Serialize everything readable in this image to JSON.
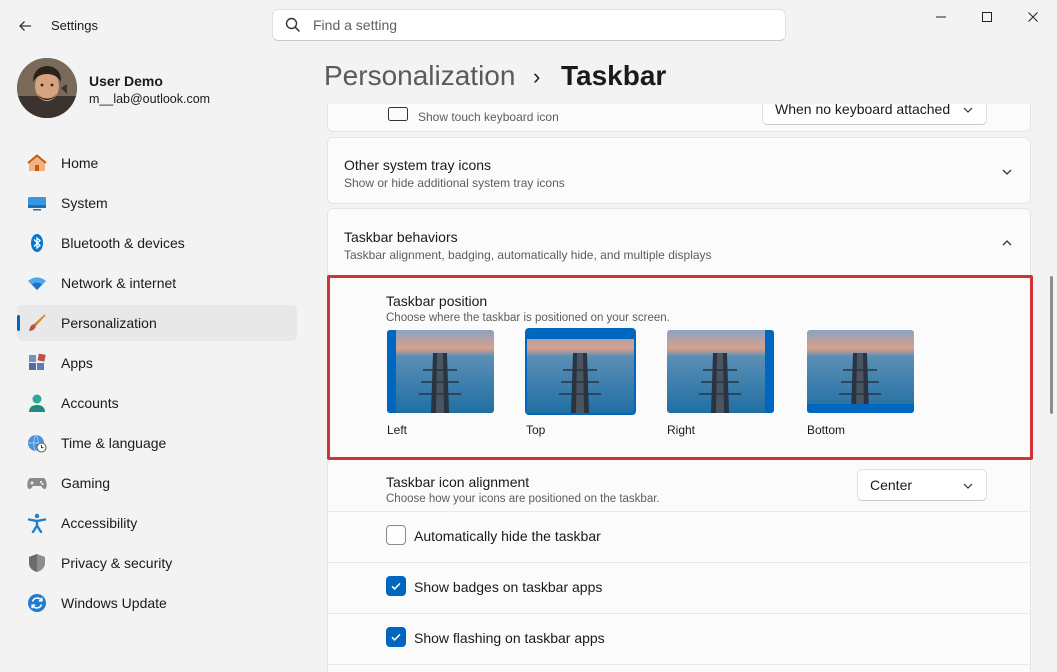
{
  "window": {
    "title": "Settings",
    "controls": [
      "minimize",
      "maximize",
      "close"
    ]
  },
  "search": {
    "placeholder": "Find a setting"
  },
  "user": {
    "name": "User Demo",
    "email": "m__lab@outlook.com"
  },
  "sidebar": {
    "items": [
      {
        "label": "Home",
        "icon": "home-icon"
      },
      {
        "label": "System",
        "icon": "system-icon"
      },
      {
        "label": "Bluetooth & devices",
        "icon": "bluetooth-icon"
      },
      {
        "label": "Network & internet",
        "icon": "wifi-icon"
      },
      {
        "label": "Personalization",
        "icon": "brush-icon",
        "active": true
      },
      {
        "label": "Apps",
        "icon": "apps-icon"
      },
      {
        "label": "Accounts",
        "icon": "accounts-icon"
      },
      {
        "label": "Time & language",
        "icon": "clock-globe-icon"
      },
      {
        "label": "Gaming",
        "icon": "gamepad-icon"
      },
      {
        "label": "Accessibility",
        "icon": "accessibility-icon"
      },
      {
        "label": "Privacy & security",
        "icon": "shield-icon"
      },
      {
        "label": "Windows Update",
        "icon": "update-icon"
      }
    ]
  },
  "header": {
    "parent": "Personalization",
    "separator": "›",
    "current": "Taskbar"
  },
  "touch_keyboard": {
    "subtitle": "Show touch keyboard icon",
    "dropdown_value": "When no keyboard attached"
  },
  "system_tray": {
    "title": "Other system tray icons",
    "subtitle": "Show or hide additional system tray icons"
  },
  "behaviors": {
    "title": "Taskbar behaviors",
    "subtitle": "Taskbar alignment, badging, automatically hide, and multiple displays",
    "position": {
      "title": "Taskbar position",
      "subtitle": "Choose where the taskbar is positioned on your screen.",
      "options": [
        {
          "label": "Left",
          "selected": false
        },
        {
          "label": "Top",
          "selected": true
        },
        {
          "label": "Right",
          "selected": false
        },
        {
          "label": "Bottom",
          "selected": false
        }
      ]
    },
    "alignment": {
      "title": "Taskbar icon alignment",
      "subtitle": "Choose how your icons are positioned on the taskbar.",
      "value": "Center"
    },
    "checkboxes": [
      {
        "label": "Automatically hide the taskbar",
        "checked": false
      },
      {
        "label": "Show badges on taskbar apps",
        "checked": true
      },
      {
        "label": "Show flashing on taskbar apps",
        "checked": true
      }
    ]
  },
  "colors": {
    "accent": "#0067c0",
    "highlight": "#d13438",
    "background": "#f3f3f3"
  }
}
